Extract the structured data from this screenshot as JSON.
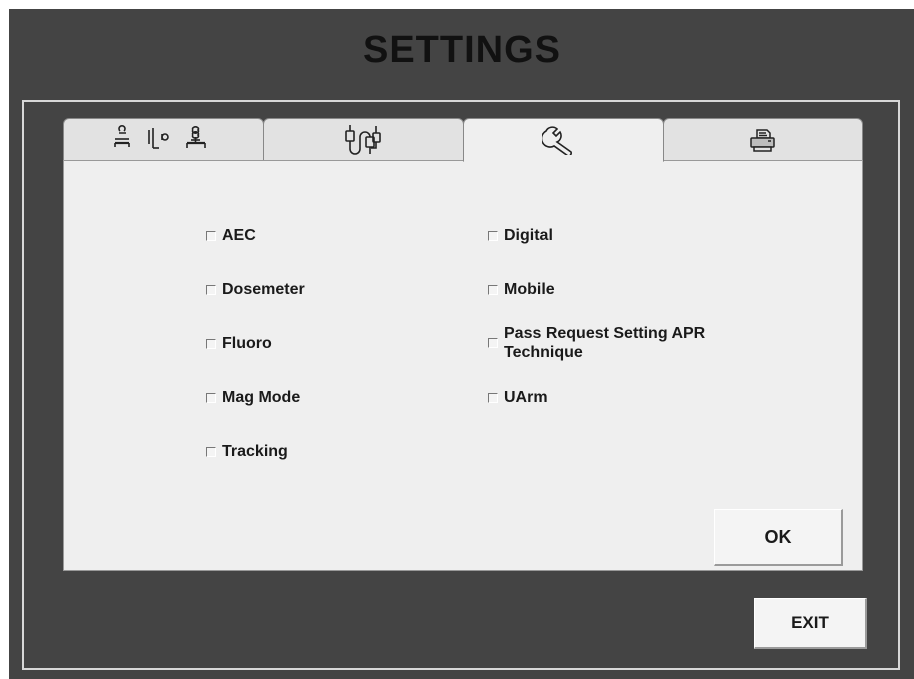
{
  "window": {
    "title": "SETTINGS"
  },
  "tabs": [
    {
      "icon": "tube-table-icon",
      "active": false
    },
    {
      "icon": "cable-connectors-icon",
      "active": false
    },
    {
      "icon": "wrench-icon",
      "active": true
    },
    {
      "icon": "printer-icon",
      "active": false
    }
  ],
  "options": {
    "left": [
      {
        "label": "AEC",
        "checked": false
      },
      {
        "label": "Dosemeter",
        "checked": false
      },
      {
        "label": "Fluoro",
        "checked": false
      },
      {
        "label": "Mag Mode",
        "checked": false
      },
      {
        "label": "Tracking",
        "checked": false
      }
    ],
    "right": [
      {
        "label": "Digital",
        "checked": false
      },
      {
        "label": "Mobile",
        "checked": false
      },
      {
        "label": "Pass Request Setting APR Technique",
        "checked": false
      },
      {
        "label": "UArm",
        "checked": false
      }
    ]
  },
  "buttons": {
    "ok": "OK",
    "exit": "EXIT"
  },
  "colors": {
    "background": "#444444",
    "panel": "#efefef",
    "border": "#d8d8d8"
  }
}
